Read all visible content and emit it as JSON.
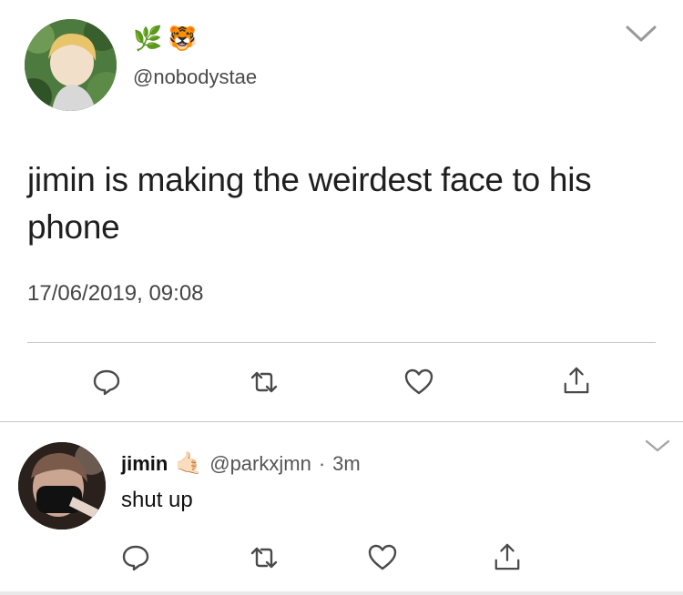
{
  "main_tweet": {
    "display_emoji": [
      "🌿",
      "🐯"
    ],
    "handle": "@nobodystae",
    "text": "jimin is making the weirdest face to his phone",
    "timestamp": "17/06/2019, 09:08",
    "actions": [
      "reply-icon",
      "retweet-icon",
      "like-icon",
      "share-icon"
    ]
  },
  "reply": {
    "name": "jimin",
    "name_emoji": "🤙🏻",
    "handle": "@parkxjmn",
    "separator": "·",
    "time": "3m",
    "text": "shut up",
    "actions": [
      "reply-icon",
      "retweet-icon",
      "like-icon",
      "share-icon"
    ]
  },
  "colors": {
    "text": "#1f1f1f",
    "muted": "#555555",
    "divider": "#c8c8c8",
    "icon": "#5a5a5a"
  }
}
